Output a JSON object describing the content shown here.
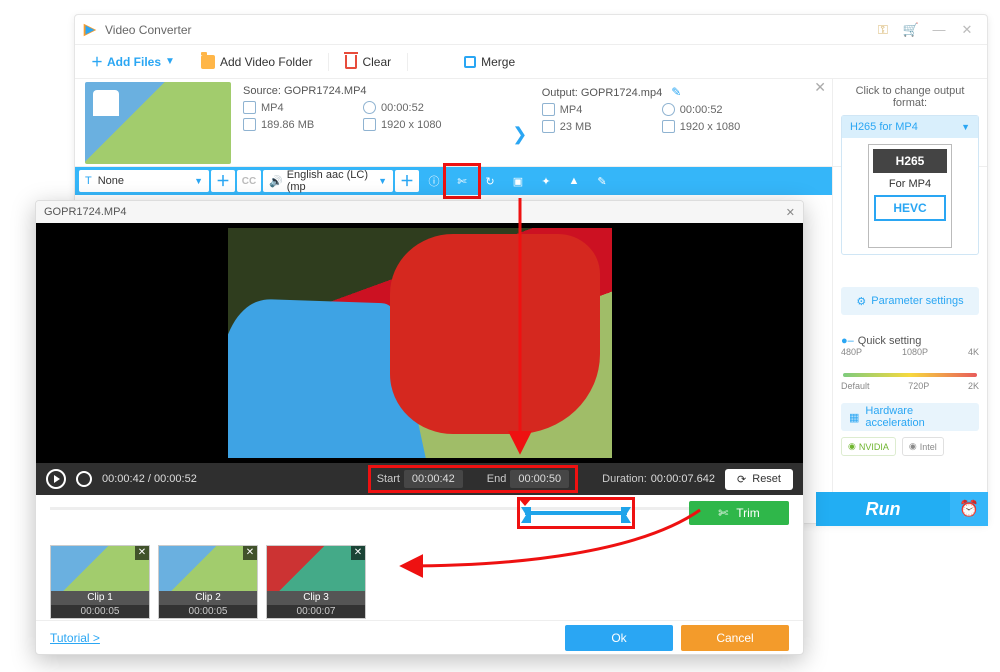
{
  "app": {
    "title": "Video Converter"
  },
  "toolbar": {
    "addFiles": "Add Files",
    "addFolder": "Add Video Folder",
    "clear": "Clear",
    "merge": "Merge"
  },
  "file": {
    "sourceLabel": "Source:",
    "sourceFile": "GOPR1724.MP4",
    "outputLabel": "Output:",
    "outputFile": "GOPR1724.mp4",
    "src": {
      "format": "MP4",
      "duration": "00:00:52",
      "size": "189.86 MB",
      "res": "1920 x 1080"
    },
    "out": {
      "format": "MP4",
      "duration": "00:00:52",
      "size": "23 MB",
      "res": "1920 x 1080"
    }
  },
  "actionBar": {
    "noneSel": "None",
    "tPrefix": "T",
    "audioSel": "English aac (LC) (mp"
  },
  "rightPanel": {
    "title": "Click to change output format:",
    "fmtName": "H265 for MP4",
    "fmtBadge1": "H265",
    "fmtBadge2": "For MP4",
    "fmtBadge3": "HEVC",
    "paramBtn": "Parameter settings",
    "qsTitle": "Quick setting",
    "qsTicksTop": [
      "480P",
      "1080P",
      "4K"
    ],
    "qsTicksBottom": [
      "Default",
      "720P",
      "2K"
    ],
    "hwBtn": "Hardware acceleration",
    "gpu1": "NVIDIA",
    "gpu2": "Intel",
    "run": "Run"
  },
  "trim": {
    "title": "GOPR1724.MP4",
    "posCurrent": "00:00:42",
    "posTotal": "00:00:52",
    "startLabel": "Start",
    "startVal": "00:00:42",
    "endLabel": "End",
    "endVal": "00:00:50",
    "durLabel": "Duration:",
    "durVal": "00:00:07.642",
    "reset": "Reset",
    "trimBtn": "Trim",
    "clips": [
      {
        "name": "Clip 1",
        "time": "00:00:05"
      },
      {
        "name": "Clip 2",
        "time": "00:00:05"
      },
      {
        "name": "Clip 3",
        "time": "00:00:07"
      }
    ],
    "tutorial": "Tutorial >",
    "ok": "Ok",
    "cancel": "Cancel"
  }
}
